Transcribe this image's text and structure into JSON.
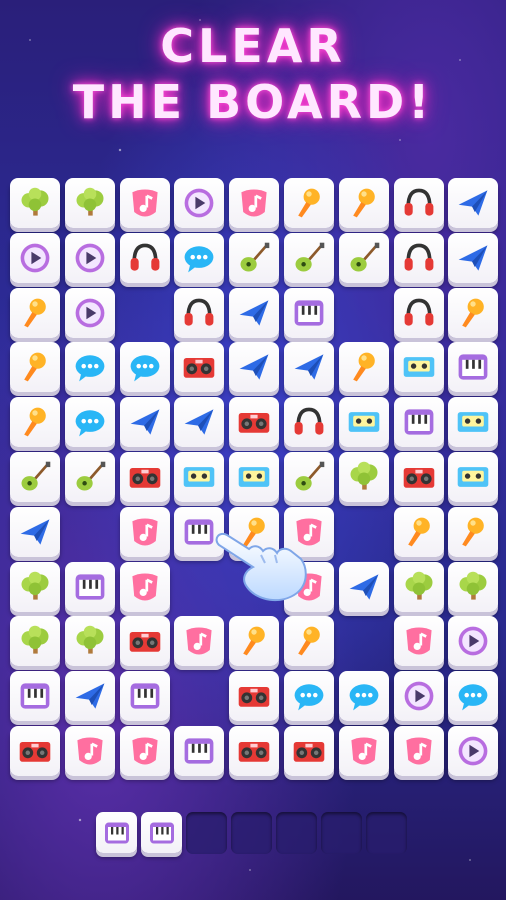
{
  "headline": {
    "line1": "CLEAR",
    "line2": "THE BOARD!"
  },
  "colors": {
    "neon_pink": "#ff2fc8",
    "tile_face": "#ffffff",
    "background": "#2c2d9a"
  },
  "board": {
    "columns": 9,
    "rows": 11,
    "grid": [
      [
        "tree",
        "tree",
        "note",
        "play",
        "note",
        "mic",
        "mic",
        "headphones",
        "plane"
      ],
      [
        "play",
        "play",
        "headphones",
        "chat",
        "guitar",
        "guitar",
        "guitar",
        "headphones",
        "plane"
      ],
      [
        "mic",
        "play",
        null,
        "headphones",
        "plane",
        "piano",
        null,
        "headphones",
        "mic"
      ],
      [
        "mic",
        "chat",
        "chat",
        "boombox",
        "plane",
        "plane",
        "mic",
        "cassette",
        "piano"
      ],
      [
        "mic",
        "chat",
        "plane",
        "plane",
        "boombox",
        "headphones",
        "cassette",
        "piano",
        "cassette"
      ],
      [
        "guitar",
        "guitar",
        "boombox",
        "cassette",
        "cassette",
        "guitar",
        "tree",
        "boombox",
        "cassette"
      ],
      [
        "plane",
        null,
        "note",
        "piano",
        "mic",
        "note",
        null,
        "mic",
        "mic"
      ],
      [
        "tree",
        "piano",
        "note",
        null,
        null,
        "note",
        "plane",
        "tree",
        "tree"
      ],
      [
        "tree",
        "tree",
        "boombox",
        "note",
        "mic",
        "mic",
        null,
        "note",
        "play"
      ],
      [
        "piano",
        "plane",
        "piano",
        null,
        "boombox",
        "chat",
        "chat",
        "play",
        "chat"
      ],
      [
        "boombox",
        "note",
        "note",
        "piano",
        "boombox",
        "boombox",
        "note",
        "note",
        "play"
      ]
    ]
  },
  "tray": {
    "slots": 7,
    "tiles": [
      "piano",
      "piano"
    ]
  },
  "pointer": {
    "icon": "pointing-hand-icon"
  }
}
